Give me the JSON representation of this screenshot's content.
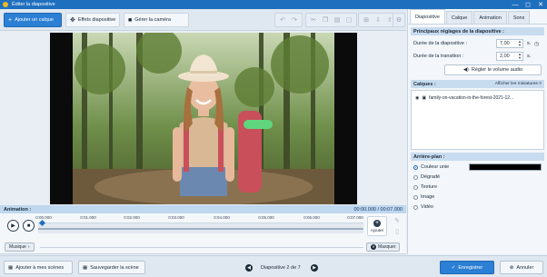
{
  "window": {
    "title": "Éditer la diapositive",
    "controls": [
      "—",
      "◻",
      "✕"
    ]
  },
  "toolbar": {
    "add_layer": "Ajouter un calque",
    "slide_effects": "Effets diapositive",
    "camera": "Gérer la caméra"
  },
  "icons": {
    "tools": [
      "undo-icon",
      "redo-icon",
      "cut-icon",
      "copy-icon",
      "paste-icon",
      "delete-icon",
      "align-icon",
      "move-down-icon",
      "move-up-icon",
      "adjust-icon"
    ]
  },
  "animation": {
    "label": "Animation :",
    "time": "00:00.000 / 00:07.000"
  },
  "timeline": {
    "ticks": [
      "0:00.000",
      "0:01.000",
      "0:02.000",
      "0:03.000",
      "0:04.000",
      "0:05.000",
      "0:06.000",
      "0:07.000"
    ],
    "add_label": "Ajouter",
    "music_label": "Musique",
    "hide_label": "Masquer"
  },
  "tabs": [
    {
      "label": "Diapositive"
    },
    {
      "label": "Calque"
    },
    {
      "label": "Animation"
    },
    {
      "label": "Sons"
    }
  ],
  "settings": {
    "header": "Principaux réglages de la diapositive :",
    "duration_label": "Durée de la diapositive :",
    "duration_value": "7,00",
    "transition_label": "Durée de la transition :",
    "transition_value": "2,00",
    "unit": "s.",
    "volume_button": "Régler le volume audio"
  },
  "layers": {
    "header": "Calques :",
    "show_thumbs": "Afficher les miniatures",
    "items": [
      {
        "name": "family-on-vacation-in-the-forest-2021-12..."
      }
    ]
  },
  "background": {
    "header": "Arrière-plan :",
    "options": [
      {
        "label": "Couleur unie",
        "selected": true
      },
      {
        "label": "Dégradé",
        "selected": false
      },
      {
        "label": "Texture",
        "selected": false
      },
      {
        "label": "Image",
        "selected": false
      },
      {
        "label": "Vidéo",
        "selected": false
      }
    ],
    "color": "#000000"
  },
  "footer": {
    "add_to_scenes": "Ajouter à mes scènes",
    "save_scene": "Sauvegarder la scène",
    "slide_counter": "Diapositive 2 de 7",
    "save": "Enregistrer",
    "cancel": "Annuler"
  },
  "colors": {
    "accent": "#2b7fd4",
    "titlebar": "#1f6fbf",
    "section": "#c8dcef"
  }
}
